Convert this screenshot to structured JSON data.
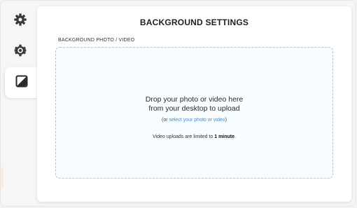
{
  "panel": {
    "title": "BACKGROUND SETTINGS",
    "section_label": "BACKGROUND PHOTO / VIDEO"
  },
  "dropzone": {
    "line1": "Drop your photo or video here",
    "line2": "from your desktop to upload",
    "sub_prefix": "(or ",
    "sub_link": "select your photo or video",
    "sub_suffix": ")",
    "note_prefix": "Video uploads are limited to ",
    "note_bold": "1 minute",
    "note_suffix": "."
  },
  "sidebar": {
    "items": [
      {
        "icon": "gear-icon"
      },
      {
        "icon": "settings-icon"
      },
      {
        "icon": "background-contrast-icon",
        "active": true
      }
    ]
  },
  "colors": {
    "link": "#3b8fd0",
    "dropzone_bg": "#f7fcfe",
    "dropzone_border": "#b8c2cc"
  }
}
